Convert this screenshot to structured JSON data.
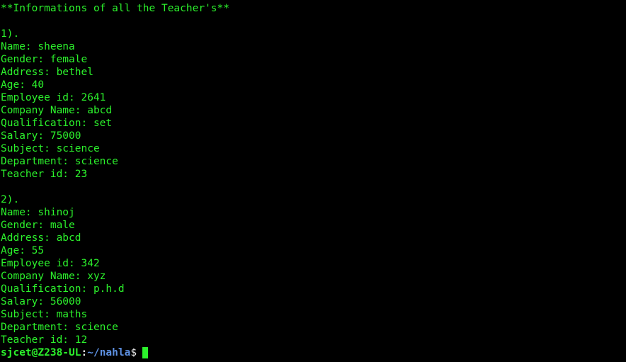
{
  "terminal": {
    "header": "**Informations of all the Teacher's**",
    "teachers": [
      {
        "index": "1).",
        "lines": [
          "Name: sheena",
          "Gender: female",
          "Address: bethel",
          "Age: 40",
          "Employee id: 2641",
          "Company Name: abcd",
          "Qualification: set",
          "Salary: 75000",
          "Subject: science",
          "Department: science",
          "Teacher id: 23"
        ]
      },
      {
        "index": "2).",
        "lines": [
          "Name: shinoj",
          "Gender: male",
          "Address: abcd",
          "Age: 55",
          "Employee id: 342",
          "Company Name: xyz",
          "Qualification: p.h.d",
          "Salary: 56000",
          "Subject: maths",
          "Department: science",
          "Teacher id: 12"
        ]
      }
    ],
    "prompt": {
      "user_host": "sjcet@Z238-UL",
      "colon": ":",
      "path": "~/nahla",
      "symbol": "$"
    },
    "colors": {
      "background": "#000000",
      "text": "#2cf22c",
      "path": "#5c8fe0"
    }
  }
}
